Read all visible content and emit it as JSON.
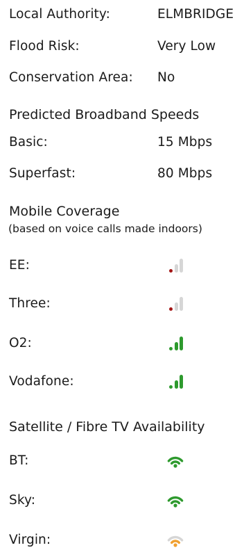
{
  "property": {
    "local_authority": {
      "label": "Local Authority:",
      "value": "ELMBRIDGE"
    },
    "flood_risk": {
      "label": "Flood Risk:",
      "value": "Very Low"
    },
    "conservation_area": {
      "label": "Conservation Area:",
      "value": "No"
    }
  },
  "broadband": {
    "heading": "Predicted Broadband Speeds",
    "basic": {
      "label": "Basic:",
      "value": "15 Mbps"
    },
    "superfast": {
      "label": "Superfast:",
      "value": "80 Mbps"
    }
  },
  "mobile": {
    "heading": "Mobile Coverage",
    "subheading": "(based on voice calls made indoors)",
    "networks": [
      {
        "label": "EE:",
        "signal_bars": 1,
        "max_bars": 3,
        "icon": "signal-bars-icon",
        "color": "#a31515"
      },
      {
        "label": "Three:",
        "signal_bars": 1,
        "max_bars": 3,
        "icon": "signal-bars-icon",
        "color": "#a31515"
      },
      {
        "label": "O2:",
        "signal_bars": 3,
        "max_bars": 3,
        "icon": "signal-bars-icon",
        "color": "#2e9a2e"
      },
      {
        "label": "Vodafone:",
        "signal_bars": 3,
        "max_bars": 3,
        "icon": "signal-bars-icon",
        "color": "#2e9a2e"
      }
    ]
  },
  "tv": {
    "heading": "Satellite / Fibre TV Availability",
    "providers": [
      {
        "label": "BT:",
        "level": 3,
        "max_level": 3,
        "icon": "wifi-icon",
        "color": "#2e9a2e"
      },
      {
        "label": "Sky:",
        "level": 3,
        "max_level": 3,
        "icon": "wifi-icon",
        "color": "#2e9a2e"
      },
      {
        "label": "Virgin:",
        "level": 2,
        "max_level": 3,
        "icon": "wifi-icon",
        "color": "#f0a030"
      }
    ]
  },
  "colors": {
    "inactive": "#d6d6d6",
    "text": "#1a1a1a"
  }
}
